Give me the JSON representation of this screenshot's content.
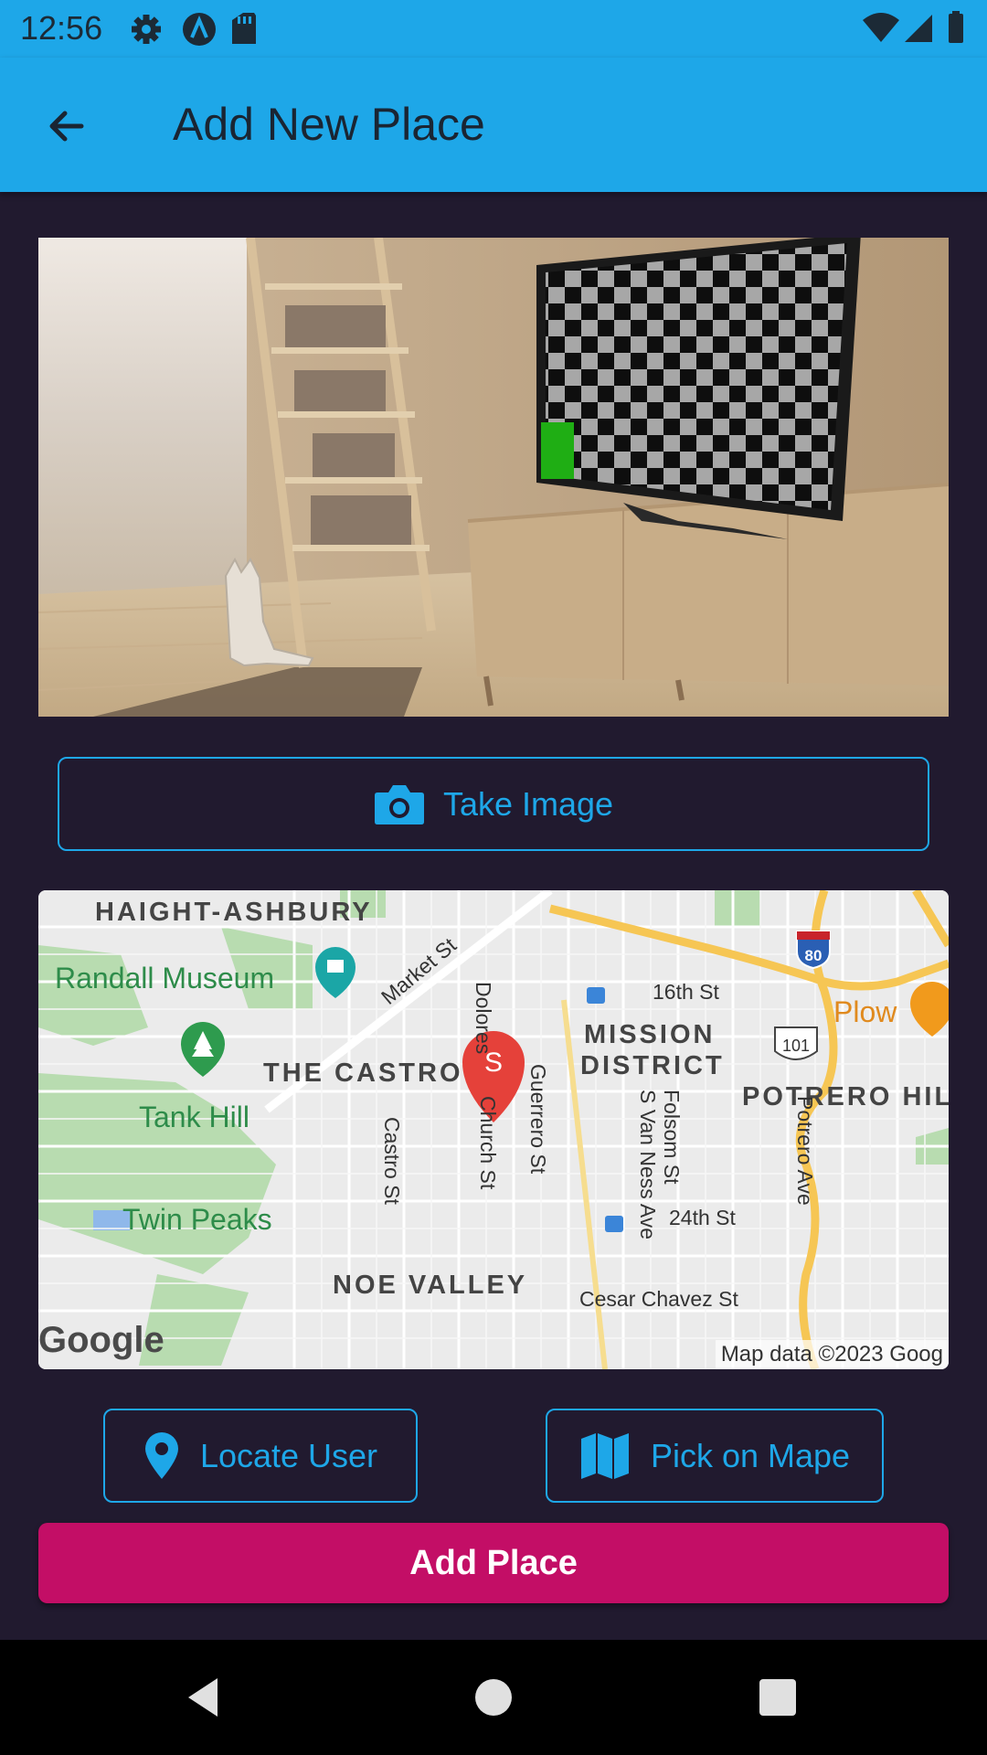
{
  "status_bar": {
    "time": "12:56",
    "left_icons": [
      "gear-icon",
      "android-studio-icon",
      "sd-card-icon"
    ],
    "right_icons": [
      "wifi-icon",
      "signal-icon",
      "battery-icon"
    ]
  },
  "app_bar": {
    "title": "Add New Place",
    "back_icon": "arrow-back-icon"
  },
  "photo": {
    "description_icon": "room-photo"
  },
  "take_image": {
    "label": "Take Image",
    "icon": "camera-icon"
  },
  "map": {
    "districts": [
      "HAIGHT-ASHBURY",
      "THE CASTRO",
      "MISSION DISTRICT",
      "POTRERO HIL",
      "NOE VALLEY"
    ],
    "mission_line1": "MISSION",
    "mission_line2": "DISTRICT",
    "parks": [
      "Randall Museum",
      "Tank Hill",
      "Twin Peaks"
    ],
    "streets": [
      "Market St",
      "Dolores",
      "16th St",
      "Guerrero St",
      "Church St",
      "Castro St",
      "S Van Ness Ave",
      "Folsom St",
      "Potrero Ave",
      "24th St",
      "Cesar Chavez St"
    ],
    "poi": "Plow",
    "highways": [
      "80",
      "101"
    ],
    "marker_letter": "S",
    "attribution": "Map data ©2023 Goog",
    "logo": "Google"
  },
  "locate_user": {
    "label": "Locate User",
    "icon": "location-pin-icon"
  },
  "pick_on_map": {
    "label": "Pick on Mape",
    "icon": "map-icon"
  },
  "add_place": {
    "label": "Add Place"
  },
  "colors": {
    "accent": "#1ea7e8",
    "background": "#211a2f",
    "primary_button": "#c30e66"
  }
}
